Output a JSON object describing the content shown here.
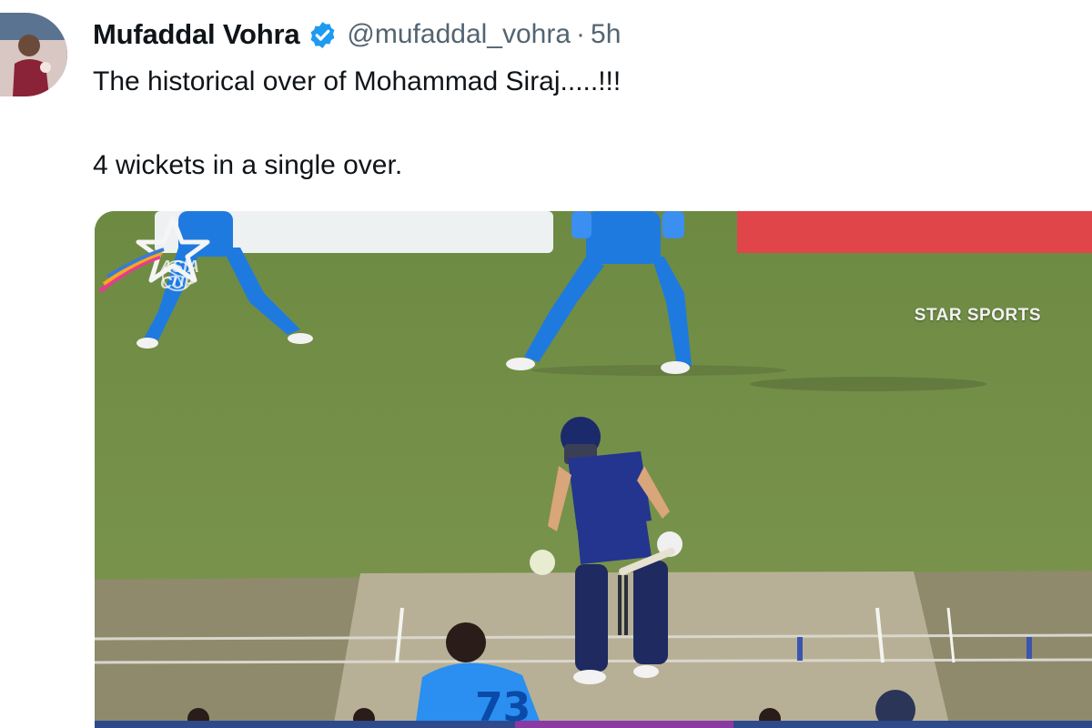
{
  "tweet": {
    "author_name": "Mufaddal Vohra",
    "handle": "@mufaddal_vohra",
    "separator": "·",
    "time": "5h",
    "line1": "The historical over of Mohammad Siraj.....!!!",
    "line2": "4 wickets in a single over."
  },
  "media": {
    "broadcast_logo": "STAR SPORTS",
    "tournament_logo_line1": "ASIA",
    "tournament_logo_line2": "CUP",
    "jersey_number": "73"
  },
  "colors": {
    "verified": "#1d9bf0",
    "handle_gray": "#536471",
    "grass": "#6f8a43",
    "india_kit": "#1f7ae0",
    "sri_lanka_kit": "#23358f"
  },
  "icons": [
    "verified-badge-icon",
    "star-sports-logo-icon",
    "asia-cup-logo-icon"
  ]
}
